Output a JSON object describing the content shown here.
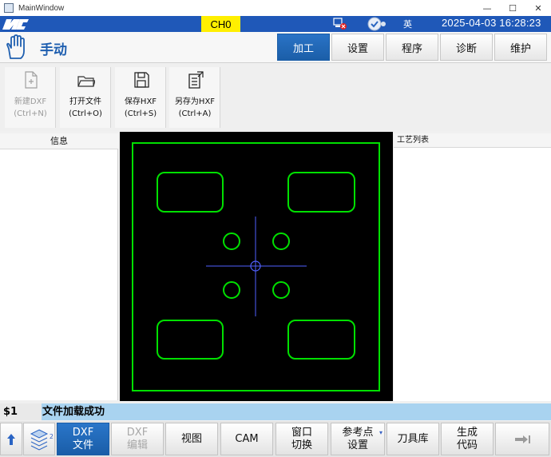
{
  "window": {
    "title": "MainWindow",
    "minimize": "—",
    "maximize": "☐",
    "close": "✕"
  },
  "status": {
    "logo": "HNC",
    "channel": "CH0",
    "language": "英",
    "datetime": "2025-04-03 16:28:23"
  },
  "mode": {
    "title": "手动"
  },
  "nav_tabs": [
    {
      "label": "加工",
      "active": true
    },
    {
      "label": "设置",
      "active": false
    },
    {
      "label": "程序",
      "active": false
    },
    {
      "label": "诊断",
      "active": false
    },
    {
      "label": "维护",
      "active": false
    }
  ],
  "toolbar": [
    {
      "label": "新建DXF\n(Ctrl+N)",
      "icon": "new-file-icon",
      "enabled": false
    },
    {
      "label": "打开文件\n(Ctrl+O)",
      "icon": "folder-open-icon",
      "enabled": true
    },
    {
      "label": "保存HXF\n(Ctrl+S)",
      "icon": "save-icon",
      "enabled": true
    },
    {
      "label": "另存为HXF\n(Ctrl+A)",
      "icon": "save-as-icon",
      "enabled": true
    }
  ],
  "panels": {
    "info_header": "信息",
    "process_list_header": "工艺列表"
  },
  "message": {
    "channel": "$1",
    "text": "文件加载成功"
  },
  "bottom_buttons": [
    {
      "label": "DXF\n文件",
      "active": true,
      "enabled": true
    },
    {
      "label": "DXF\n编辑",
      "active": false,
      "enabled": false
    },
    {
      "label": "视图",
      "active": false,
      "enabled": true
    },
    {
      "label": "CAM",
      "active": false,
      "enabled": true
    },
    {
      "label": "窗口\n切换",
      "active": false,
      "enabled": true
    },
    {
      "label": "参考点\n设置",
      "active": false,
      "enabled": true
    },
    {
      "label": "刀具库",
      "active": false,
      "enabled": true
    },
    {
      "label": "生成\n代码",
      "active": false,
      "enabled": true
    }
  ],
  "layer_badge": "2",
  "colors": {
    "accent": "#1f58b8",
    "channel_bg": "#ffef00",
    "message_bg": "#a9d3f0",
    "geometry": "#00e000",
    "crosshair": "#5060ff"
  }
}
